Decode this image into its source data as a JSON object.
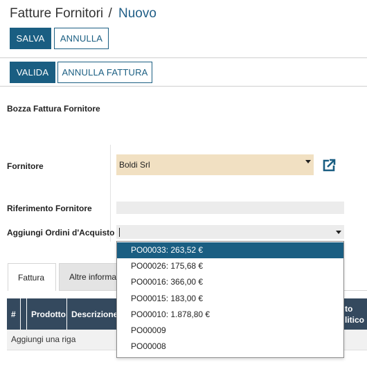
{
  "header": {
    "title": "Fatture Fornitori",
    "separator": "/",
    "breadcrumb": "Nuovo"
  },
  "toolbar": {
    "save_label": "SALVA",
    "cancel_label": "ANNULLA"
  },
  "status_bar": {
    "validate_label": "VALIDA",
    "cancel_invoice_label": "ANNULLA FATTURA"
  },
  "form": {
    "status_title": "Bozza Fattura Fornitore",
    "supplier_label": "Fornitore",
    "supplier_value": "Boldi Srl",
    "reference_label": "Riferimento Fornitore",
    "reference_value": "",
    "purchase_orders_label": "Aggiungi Ordini d'Acquisto",
    "purchase_orders_value": ""
  },
  "dropdown": {
    "options": [
      "PO00033: 263,52 €",
      "PO00026: 175,68 €",
      "PO00016: 366,00 €",
      "PO00015: 183,00 €",
      "PO00010: 1.878,80 €",
      "PO00009",
      "PO00008"
    ],
    "selected_index": 0
  },
  "tabs": [
    {
      "label": "Fattura",
      "active": true
    },
    {
      "label": "Altre informa",
      "active": false
    }
  ],
  "table": {
    "columns": [
      "#",
      "",
      "Prodotto",
      "Descrizione"
    ],
    "right_header_line1": "to",
    "right_header_line2": "litico",
    "add_row_label": "Aggiungi una riga"
  },
  "colors": {
    "primary": "#1a5e82",
    "supplier_field_bg": "#f1e0c2",
    "table_header_bg": "#34495e",
    "selected_option_bg": "#1a5e82"
  }
}
